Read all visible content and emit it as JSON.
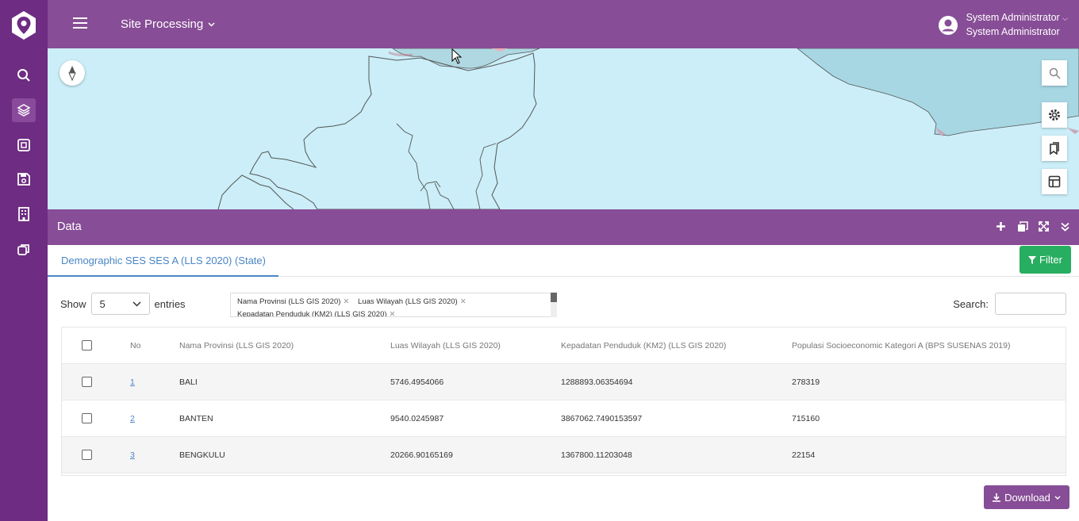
{
  "topbar": {
    "app_title": "Site Processing",
    "user_name": "System Administrator",
    "user_role": "System Administrator"
  },
  "sidebar": {
    "items": [
      {
        "icon": "search-icon"
      },
      {
        "icon": "layers-icon"
      },
      {
        "icon": "frame-icon"
      },
      {
        "icon": "save-icon"
      },
      {
        "icon": "building-icon"
      },
      {
        "icon": "copy-icon"
      }
    ]
  },
  "map": {
    "controls": [
      "compass-icon",
      "map-search-icon",
      "settings-icon",
      "bookmark-icon",
      "table-icon"
    ]
  },
  "panel": {
    "title": "Data"
  },
  "tabs": [
    {
      "label": "Demographic SES SES A (LLS 2020) (State)"
    }
  ],
  "filter_label": "Filter",
  "controls": {
    "show_label": "Show",
    "entries_value": "5",
    "entries_label": "entries",
    "search_label": "Search:",
    "column_tags": [
      "Nama Provinsi (LLS GIS 2020)",
      "Luas Wilayah (LLS GIS 2020)",
      "Kepadatan Penduduk (KM2) (LLS GIS 2020)"
    ]
  },
  "table": {
    "columns": [
      "No",
      "Nama Provinsi (LLS GIS 2020)",
      "Luas Wilayah (LLS GIS 2020)",
      "Kepadatan Penduduk (KM2) (LLS GIS 2020)",
      "Populasi Socioeconomic Kategori A (BPS SUSENAS 2019)"
    ],
    "rows": [
      {
        "no": "1",
        "provinsi": "BALI",
        "luas": "5746.4954066",
        "kepadatan": "1288893.06354694",
        "populasi": "278319"
      },
      {
        "no": "2",
        "provinsi": "BANTEN",
        "luas": "9540.0245987",
        "kepadatan": "3867062.7490153597",
        "populasi": "715160"
      },
      {
        "no": "3",
        "provinsi": "BENGKULU",
        "luas": "20266.90165169",
        "kepadatan": "1367800.11203048",
        "populasi": "22154"
      }
    ]
  },
  "download_label": "Download",
  "colors": {
    "sidebar": "#6e2c82",
    "topbar": "#874d96",
    "map_water": "#cbeef8",
    "filter_green": "#27ae60",
    "link_blue": "#4a86c5"
  }
}
